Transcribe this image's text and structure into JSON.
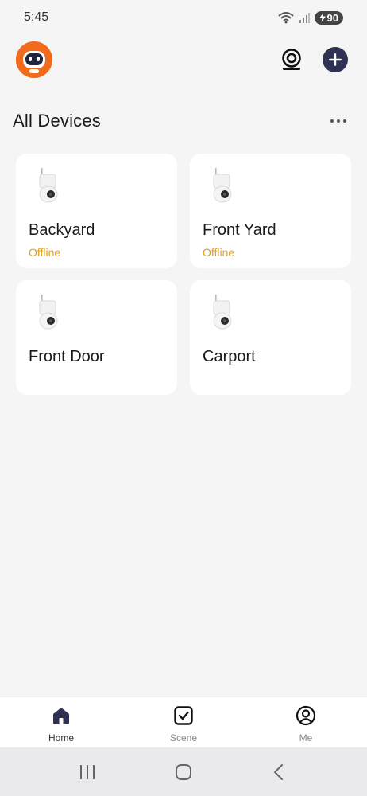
{
  "status_bar": {
    "time": "5:45",
    "battery": "90"
  },
  "header": {
    "avatar_icon": "robot-avatar-icon",
    "camera_icon": "webcam-icon",
    "add_icon": "plus-icon"
  },
  "section": {
    "title": "All Devices",
    "more_icon": "more-dots-icon"
  },
  "devices": [
    {
      "name": "Backyard",
      "status": "Offline"
    },
    {
      "name": "Front Yard",
      "status": "Offline"
    },
    {
      "name": "Front Door",
      "status": ""
    },
    {
      "name": "Carport",
      "status": ""
    }
  ],
  "bottom_nav": {
    "items": [
      {
        "label": "Home",
        "icon": "home-icon",
        "active": true
      },
      {
        "label": "Scene",
        "icon": "checkbox-icon",
        "active": false
      },
      {
        "label": "Me",
        "icon": "user-circle-icon",
        "active": false
      }
    ]
  },
  "colors": {
    "accent": "#2e3152",
    "offline": "#e0a31a",
    "avatar": "#f26b1d",
    "background": "#f5f5f5"
  }
}
